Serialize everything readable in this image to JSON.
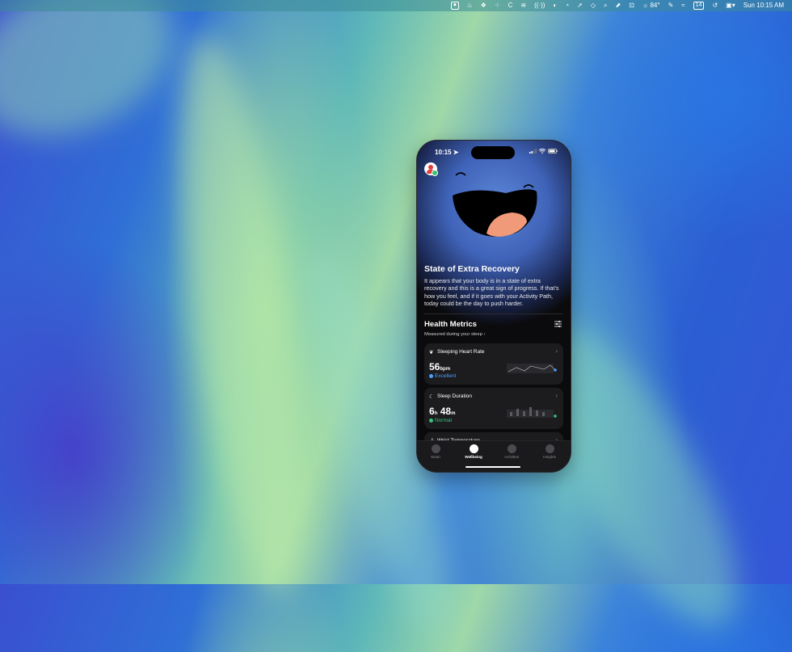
{
  "menubar": {
    "temperature": "84°",
    "calendar_day": "14",
    "clock": "Sun 10:15 AM"
  },
  "phone": {
    "status_time": "10:15",
    "hero": {
      "title": "State of Extra Recovery",
      "description": "It appears that your body is in a state of extra recovery and this is a great sign of progress. If that’s how you feel, and if it goes with your Activity Path, today could be the day to push harder."
    },
    "health_metrics": {
      "title": "Health Metrics",
      "subtitle": "Measured during your sleep ›",
      "cards": [
        {
          "label": "Sleeping Heart Rate",
          "value": "56",
          "unit": "bpm",
          "status": "Excellent",
          "status_color": "#4a9fff"
        },
        {
          "label": "Sleep Duration",
          "value_h": "6",
          "unit_h": "h",
          "value_m": "48",
          "unit_m": "m",
          "status": "Normal",
          "status_color": "#34c77b"
        },
        {
          "label": "Wrist Temperature"
        }
      ]
    },
    "tabs": [
      {
        "label": "Strain"
      },
      {
        "label": "Wellbeing"
      },
      {
        "label": "Activities"
      },
      {
        "label": "Insights"
      }
    ]
  }
}
